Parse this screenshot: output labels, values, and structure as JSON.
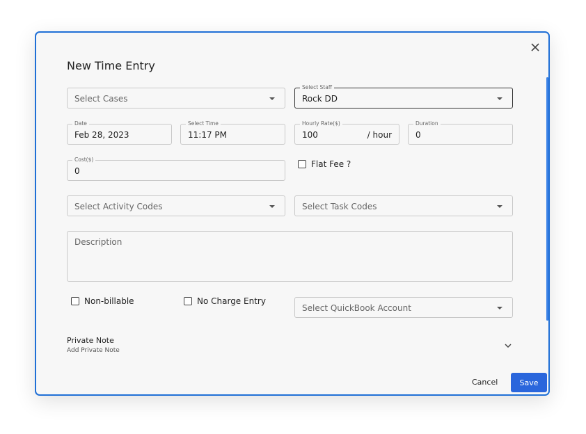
{
  "dialog": {
    "title": "New Time Entry",
    "close_icon": "close-icon"
  },
  "fields": {
    "cases": {
      "placeholder": "Select Cases"
    },
    "staff": {
      "label": "Select Staff",
      "value": "Rock DD"
    },
    "date": {
      "label": "Date",
      "value": "Feb 28, 2023"
    },
    "time": {
      "label": "Select Time",
      "value": "11:17 PM"
    },
    "rate": {
      "label": "Hourly Rate($)",
      "value": "100",
      "suffix": "/ hour"
    },
    "duration": {
      "label": "Duration",
      "value": "0"
    },
    "cost": {
      "label": "Cost($)",
      "value": "0"
    },
    "activity": {
      "placeholder": "Select Activity Codes"
    },
    "task": {
      "placeholder": "Select Task Codes"
    },
    "description": {
      "placeholder": "Description"
    },
    "quickbook": {
      "placeholder": "Select QuickBook Account"
    }
  },
  "checkboxes": {
    "flat_fee": "Flat Fee ?",
    "non_billable": "Non-billable",
    "no_charge": "No Charge Entry"
  },
  "private_note": {
    "title": "Private Note",
    "subtitle": "Add Private Note"
  },
  "footer": {
    "cancel_label": "Cancel",
    "save_label": "Save"
  },
  "colors": {
    "accent": "#2a66dc",
    "border": "#1f6fd6"
  }
}
